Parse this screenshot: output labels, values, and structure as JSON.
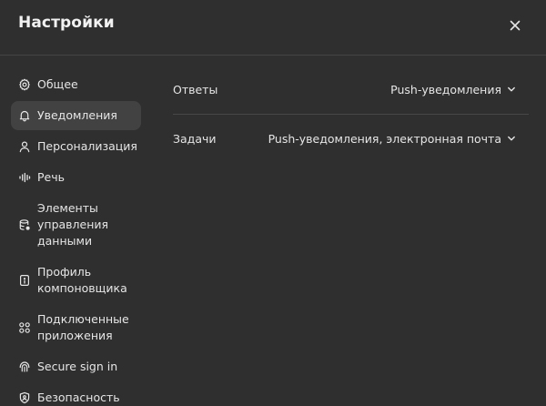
{
  "dialog": {
    "title": "Настройки"
  },
  "sidebar": {
    "items": [
      {
        "id": "general",
        "label": "Общее",
        "icon": "gear-icon"
      },
      {
        "id": "notifications",
        "label": "Уведомления",
        "icon": "bell-icon",
        "active": true
      },
      {
        "id": "personalization",
        "label": "Персонализация",
        "icon": "person-icon"
      },
      {
        "id": "speech",
        "label": "Речь",
        "icon": "waveform-icon"
      },
      {
        "id": "data-controls",
        "label": "Элементы управления данными",
        "icon": "database-icon"
      },
      {
        "id": "builder-profile",
        "label": "Профиль компоновщика",
        "icon": "id-card-icon"
      },
      {
        "id": "connected-apps",
        "label": "Подключенные приложения",
        "icon": "apps-icon"
      },
      {
        "id": "secure-sign-in",
        "label": "Secure sign in",
        "icon": "secure-signin-icon"
      },
      {
        "id": "security",
        "label": "Безопасность",
        "icon": "shield-icon"
      }
    ]
  },
  "settings": {
    "rows": [
      {
        "label": "Ответы",
        "value": "Push-уведомления"
      },
      {
        "label": "Задачи",
        "value": "Push-уведомления, электронная почта"
      }
    ]
  },
  "colors": {
    "background": "#2f2f2f",
    "active_item": "#424242",
    "divider": "#474747",
    "text": "#e6e6e6"
  }
}
